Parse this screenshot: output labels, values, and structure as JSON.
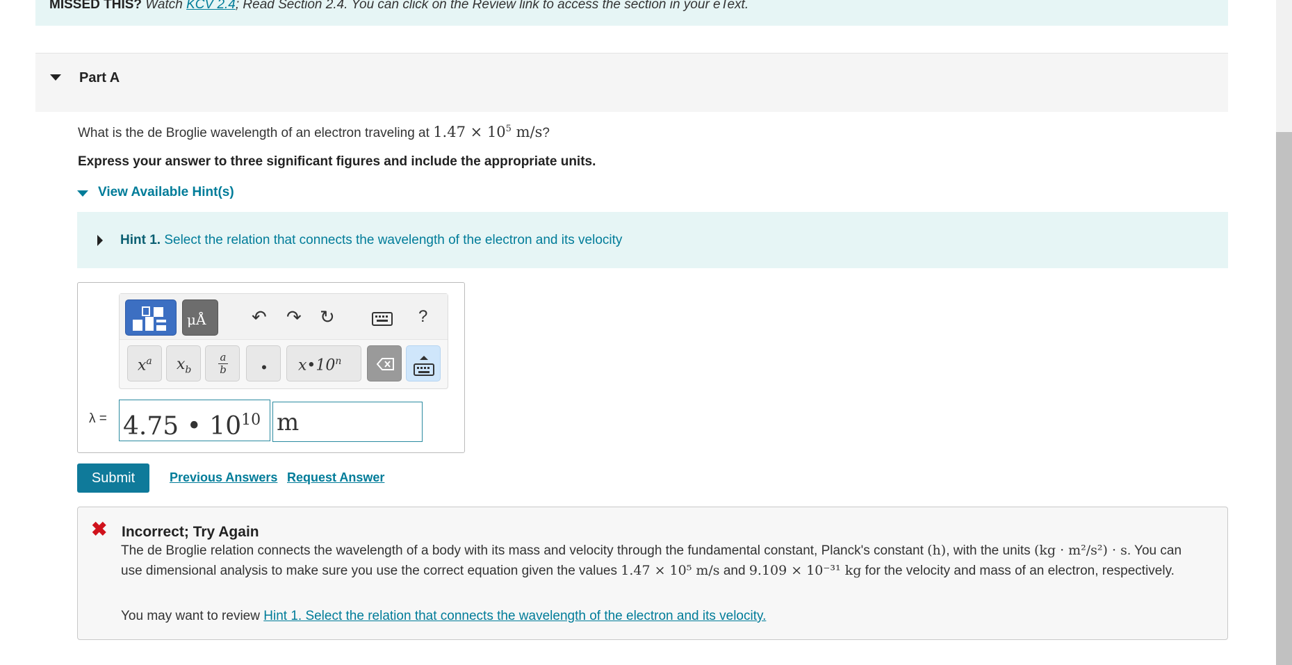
{
  "banner": {
    "missed_label": "MISSED THIS?",
    "watch_text": "Watch",
    "kcv_link": "KCV 2.4",
    "rest_text": "; Read Section 2.4. You can click on the Review link to access the section in your eText."
  },
  "part": {
    "title": "Part A"
  },
  "question": {
    "text": "What is the de Broglie wavelength of an electron traveling at",
    "value_mantissa": "1.47",
    "times": "×",
    "value_base": "10",
    "value_exp": "5",
    "value_units": "m/s",
    "end": "?"
  },
  "instruction": "Express your answer to three significant figures and include the appropriate units.",
  "hints": {
    "toggle_label": "View Available Hint(s)",
    "hint1_label": "Hint 1.",
    "hint1_text": "Select the relation that connects the wavelength of the electron and its velocity"
  },
  "toolbar": {
    "units_label": "μÅ",
    "help_label": "?",
    "keys": {
      "superscript_base": "x",
      "superscript_exp": "a",
      "subscript_base": "x",
      "subscript_sub": "b",
      "frac_num": "a",
      "frac_den": "b",
      "dot": "•",
      "sci": "x•10",
      "sci_exp": "n"
    }
  },
  "answer": {
    "symbol": "λ =",
    "value_mantissa": "4.75",
    "value_dot": "•",
    "value_base": "10",
    "value_exp": "10",
    "units": "m"
  },
  "actions": {
    "submit": "Submit",
    "previous_answers": "Previous Answers",
    "request_answer": "Request Answer"
  },
  "feedback": {
    "title": "Incorrect; Try Again",
    "body_1": "The de Broglie relation connects the wavelength of a body with its mass and velocity through the fundamental constant, Planck's constant",
    "planck_symbol": "(h)",
    "body_2": ", with the units",
    "planck_units": "(kg · m²/s²) · s",
    "body_3": ". You can use dimensional analysis to make sure you use the correct equation given the values",
    "velocity_value": "1.47 × 10⁵ m/s",
    "and_text": "and",
    "mass_value": "9.109 × 10⁻³¹ kg",
    "body_4": "for the velocity and mass of an electron, respectively.",
    "review_prefix": "You may want to review",
    "review_link": "Hint 1. Select the relation that connects the wavelength of the electron and its velocity."
  },
  "colors": {
    "accent": "#007c99",
    "hint_background": "#e6f5f5",
    "submit_background": "#0f7a9a",
    "error_red": "#d0121c"
  }
}
